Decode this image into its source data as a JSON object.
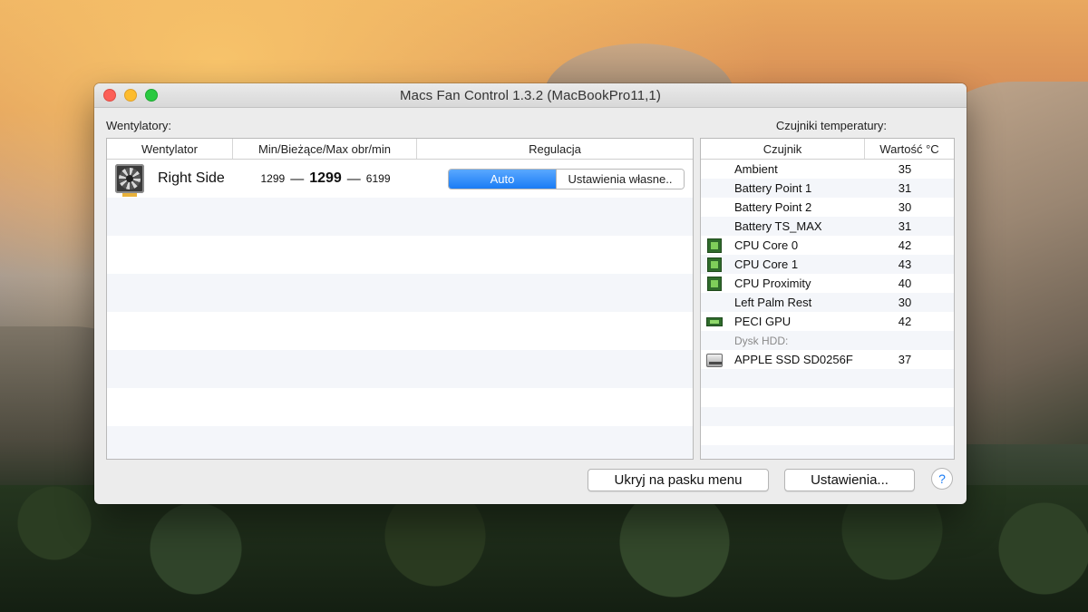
{
  "window": {
    "title": "Macs Fan Control 1.3.2 (MacBookPro11,1)"
  },
  "fans": {
    "section_label": "Wentylatory:",
    "columns": [
      "Wentylator",
      "Min/Bieżące/Max obr/min",
      "Regulacja"
    ],
    "rows": [
      {
        "name": "Right Side",
        "min_rpm": "1299",
        "current_rpm": "1299",
        "max_rpm": "6199",
        "separator": "—",
        "control_auto": "Auto",
        "control_custom": "Ustawienia własne.."
      }
    ]
  },
  "sensors": {
    "section_label": "Czujniki temperatury:",
    "columns": [
      "Czujnik",
      "Wartość °C"
    ],
    "rows": [
      {
        "name": "Ambient",
        "value": "35",
        "icon": "none"
      },
      {
        "name": "Battery Point 1",
        "value": "31",
        "icon": "none"
      },
      {
        "name": "Battery Point 2",
        "value": "30",
        "icon": "none"
      },
      {
        "name": "Battery TS_MAX",
        "value": "31",
        "icon": "none"
      },
      {
        "name": "CPU Core 0",
        "value": "42",
        "icon": "cpu-chip-icon"
      },
      {
        "name": "CPU Core 1",
        "value": "43",
        "icon": "cpu-chip-icon"
      },
      {
        "name": "CPU Proximity",
        "value": "40",
        "icon": "cpu-chip-icon"
      },
      {
        "name": "Left Palm Rest",
        "value": "30",
        "icon": "none"
      },
      {
        "name": "PECI GPU",
        "value": "42",
        "icon": "gpu-card-icon"
      },
      {
        "group": "Dysk HDD:"
      },
      {
        "name": "APPLE SSD SD0256F",
        "value": "37",
        "icon": "disk-drive-icon"
      }
    ]
  },
  "buttons": {
    "hide_in_menubar": "Ukryj na pasku menu",
    "settings": "Ustawienia...",
    "help": "?"
  },
  "colors": {
    "accent": "#1a7cf5",
    "close": "#fc5f57",
    "minimize": "#fdbc2e",
    "maximize": "#29c940"
  }
}
